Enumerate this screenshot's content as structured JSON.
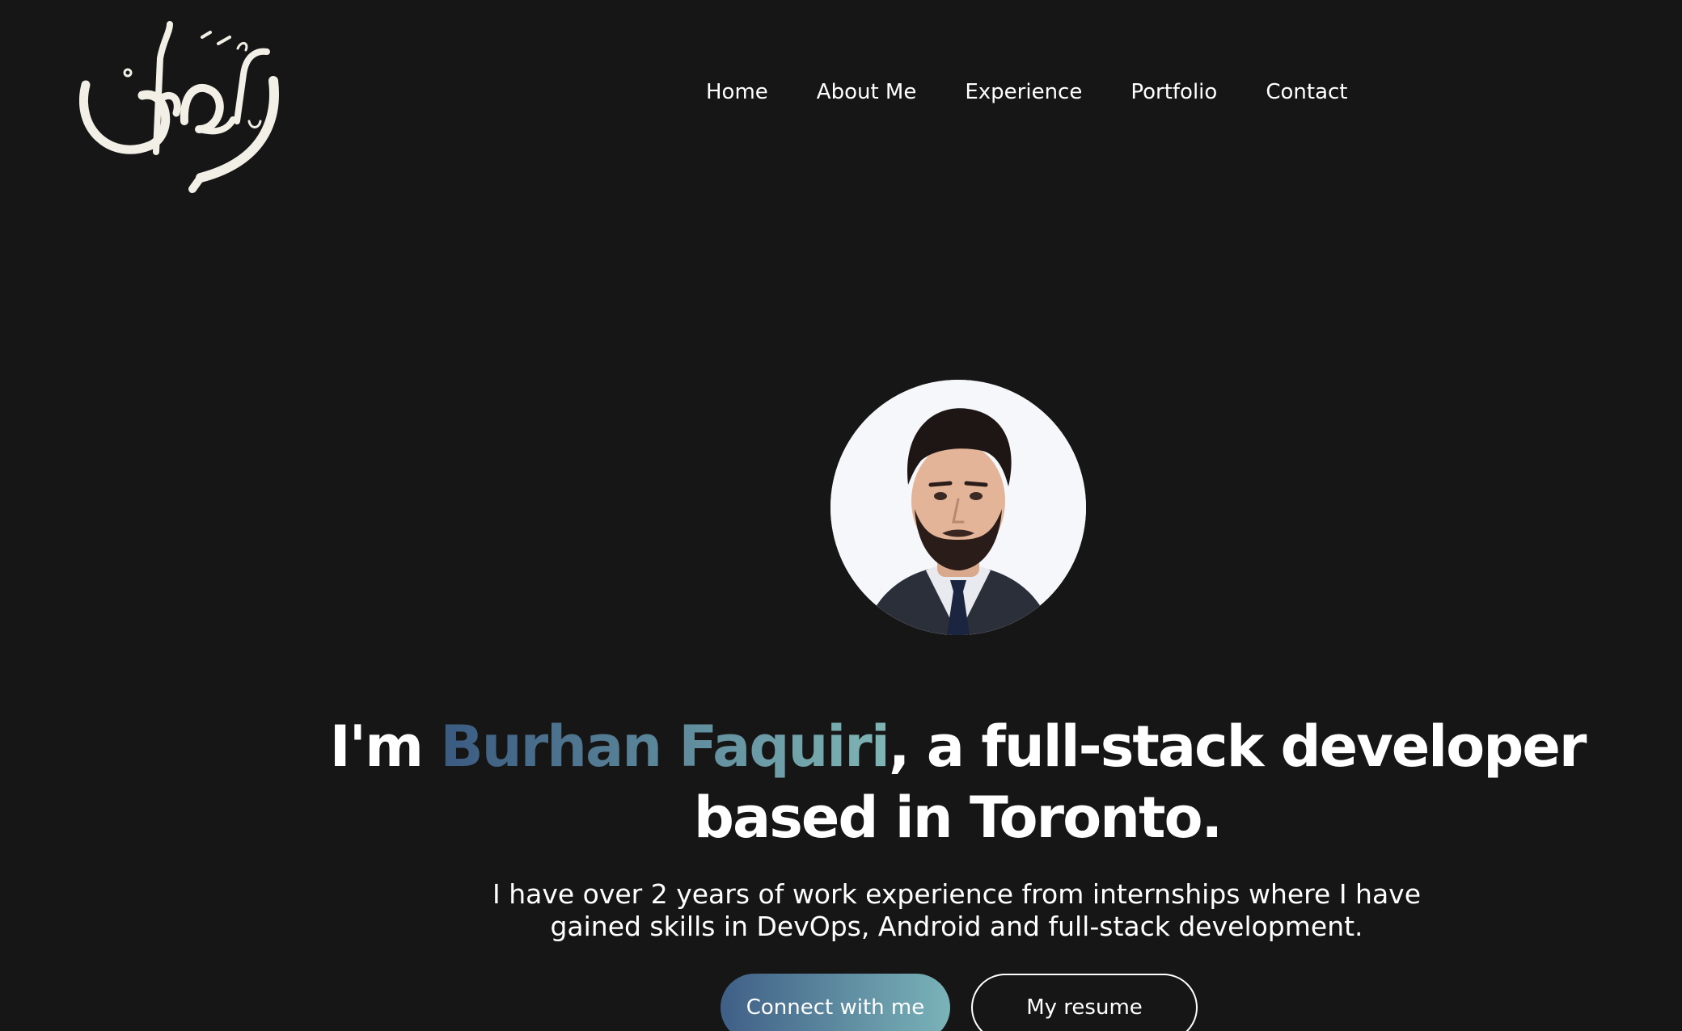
{
  "logo": {
    "alt": "برهان",
    "icon": "arabic-calligraphy-logo"
  },
  "nav": {
    "items": [
      {
        "label": "Home"
      },
      {
        "label": "About Me"
      },
      {
        "label": "Experience"
      },
      {
        "label": "Portfolio"
      },
      {
        "label": "Contact"
      }
    ]
  },
  "hero": {
    "avatar_icon": "profile-photo",
    "headline_prefix": "I'm ",
    "headline_name": "Burhan Faquiri",
    "headline_suffix": ", a full-stack developer based in Toronto.",
    "description": "I have over 2 years of work experience from internships where I have gained skills in DevOps, Android and full-stack development.",
    "primary_button": "Connect with me",
    "secondary_button": "My resume"
  },
  "colors": {
    "background": "#171616",
    "text": "#ffffff",
    "gradient_start": "#3a5a80",
    "gradient_end": "#7fb5b5"
  }
}
